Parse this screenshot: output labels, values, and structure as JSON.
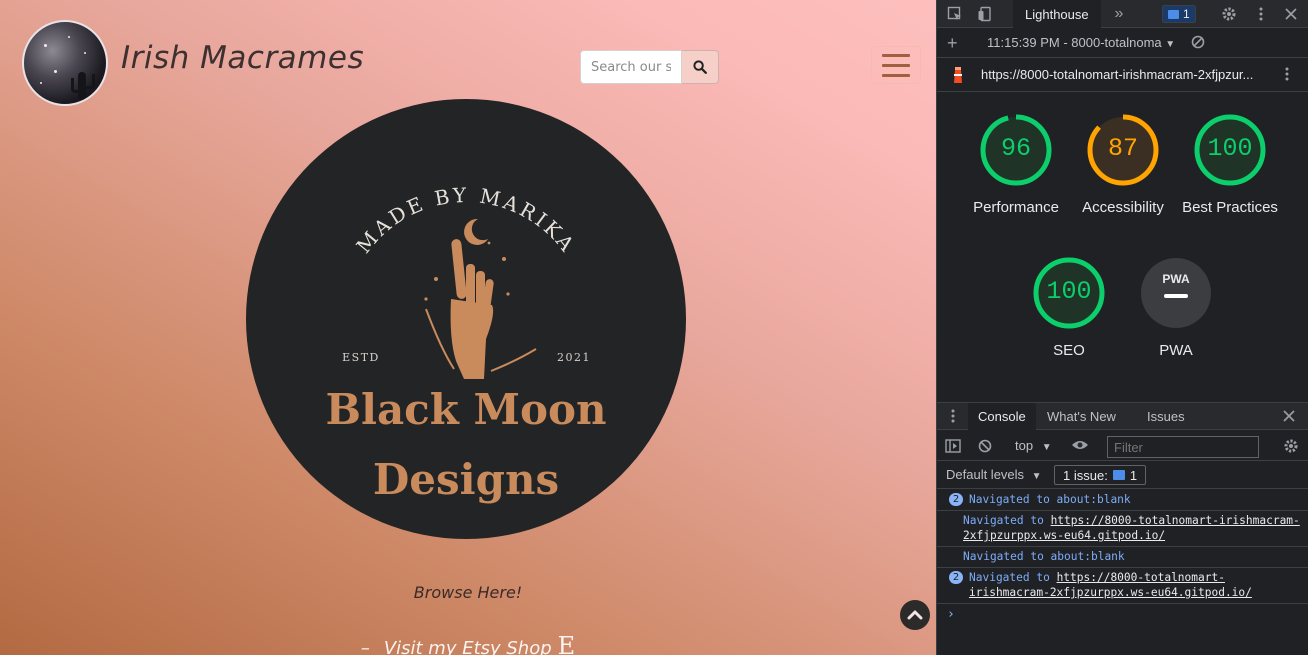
{
  "site": {
    "brand_title": "Irish Macrames",
    "search": {
      "placeholder": "Search our site"
    },
    "hero": {
      "arc_text": "MADE BY MARIKA",
      "estd_label": "ESTD",
      "year": "2021",
      "line1": "Black Moon",
      "line2": "Designs"
    },
    "browse_label": "Browse Here!",
    "etsy": {
      "dash": "–",
      "label": "Visit my Etsy Shop",
      "icon_letter": "E"
    }
  },
  "devtools": {
    "active_tab": "Lighthouse",
    "more_tabs": "»",
    "issue_badge_count": "1",
    "report_selector": "11:15:39 PM - 8000-totalnoma",
    "url": "https://8000-totalnomart-irishmacram-2xfjpzur...",
    "scores": [
      {
        "label": "Performance",
        "value": "96",
        "score": 0.96,
        "color": "#0cce6b"
      },
      {
        "label": "Accessibility",
        "value": "87",
        "score": 0.87,
        "color": "#ffa400"
      },
      {
        "label": "Best Practices",
        "value": "100",
        "score": 1.0,
        "color": "#0cce6b"
      },
      {
        "label": "SEO",
        "value": "100",
        "score": 1.0,
        "color": "#0cce6b"
      },
      {
        "label": "PWA",
        "value": "",
        "badge": "PWA"
      }
    ],
    "drawer_tabs": [
      "Console",
      "What's New",
      "Issues"
    ],
    "context_selector": "top",
    "filter_placeholder": "Filter",
    "default_levels": "Default levels",
    "issues_pill": "1 issue:",
    "issues_pill_count": "1",
    "console_messages": [
      {
        "count": "2",
        "text": "Navigated to about:blank",
        "link": ""
      },
      {
        "count": "",
        "text": "Navigated to ",
        "link": "https://8000-totalnomart-irishmacram-2xfjpzurppx.ws-eu64.gitpod.io/"
      },
      {
        "count": "",
        "text": "Navigated to about:blank",
        "link": ""
      },
      {
        "count": "2",
        "text": "Navigated to ",
        "link": "https://8000-totalnomart-irishmacram-2xfjpzurppx.ws-eu64.gitpod.io/"
      }
    ],
    "prompt_symbol": "›"
  }
}
